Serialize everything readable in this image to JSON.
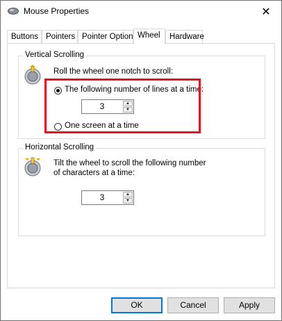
{
  "window": {
    "title": "Mouse Properties",
    "close_glyph": "✕"
  },
  "tabs": [
    {
      "label": "Buttons",
      "active": false
    },
    {
      "label": "Pointers",
      "active": false
    },
    {
      "label": "Pointer Options",
      "active": false
    },
    {
      "label": "Wheel",
      "active": true
    },
    {
      "label": "Hardware",
      "active": false
    }
  ],
  "vertical": {
    "heading": "Vertical Scrolling",
    "instruction": "Roll the wheel one notch to scroll:",
    "option_lines": "The following number of lines at a time:",
    "option_lines_selected": true,
    "lines_value": "3",
    "option_screen": "One screen at a time",
    "option_screen_selected": false
  },
  "horizontal": {
    "heading": "Horizontal Scrolling",
    "instruction_line1": "Tilt the wheel to scroll the following number",
    "instruction_line2": "of characters at a time:",
    "chars_value": "3"
  },
  "buttons": {
    "ok": "OK",
    "cancel": "Cancel",
    "apply": "Apply"
  },
  "highlight_color": "#e81123",
  "accent_color": "#0078d7"
}
